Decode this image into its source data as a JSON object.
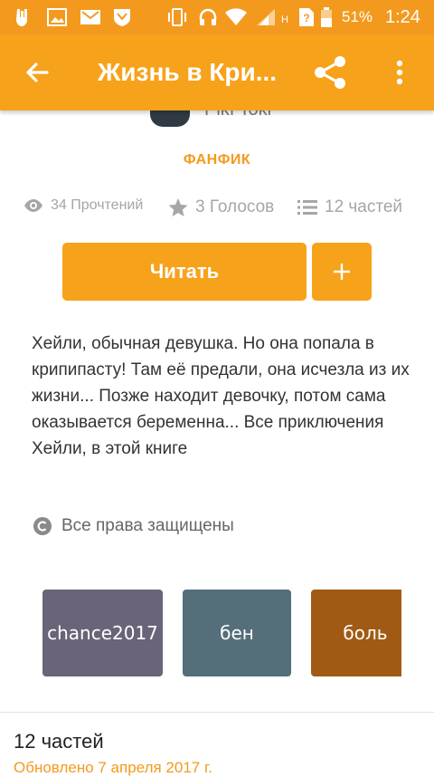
{
  "status_bar": {
    "battery_percent": "51%",
    "time": "1:24",
    "network_letter": "H"
  },
  "toolbar": {
    "title": "Жизнь в Кри...",
    "back_icon": "arrow-left-icon",
    "share_icon": "share-icon",
    "more_icon": "more-vert-icon"
  },
  "story": {
    "author_peek": "Pikı Toki",
    "category": "ФАНФИК",
    "stats": {
      "reads": "34 Прочтений",
      "votes": "3 Голосов",
      "parts": "12 частей"
    },
    "read_button": "Читать",
    "add_button": "+",
    "description": "Хейли, обычная девушка. Но она попала в крипипасту! Там её предали, она исчезла из их жизни... Позже находит девочку, потом сама оказывается беременна... Все приключения Хейли, в этой книге",
    "rights": "Все права защищены"
  },
  "tags": [
    {
      "label": "chance2017",
      "color": "#6a6478"
    },
    {
      "label": "бен",
      "color": "#546e7a"
    },
    {
      "label": "боль",
      "color": "#a05a14"
    }
  ],
  "parts_section": {
    "title": "12 частей",
    "updated": "Обновлено 7 апреля 2017 г."
  },
  "colors": {
    "accent": "#f7a21b",
    "statusbar": "#f39a1e"
  }
}
